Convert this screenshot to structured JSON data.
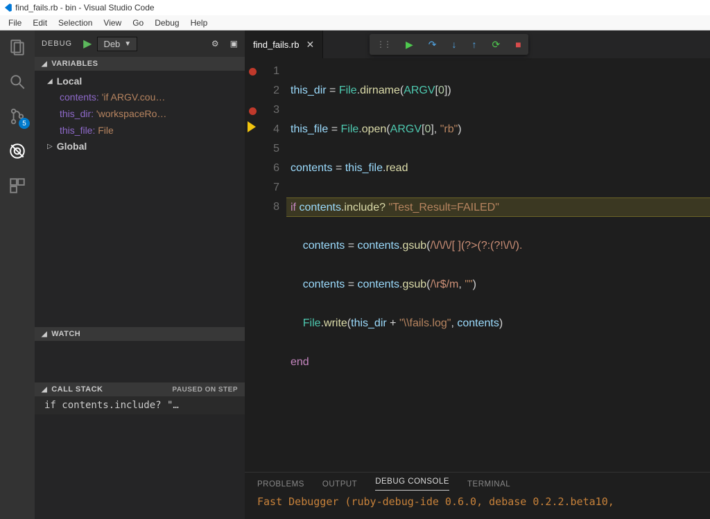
{
  "title": "find_fails.rb - bin - Visual Studio Code",
  "menubar": [
    "File",
    "Edit",
    "Selection",
    "View",
    "Go",
    "Debug",
    "Help"
  ],
  "activitybar": {
    "debug_badge": "5"
  },
  "debug_header": {
    "label": "DEBUG",
    "config": "Deb"
  },
  "sections": {
    "variables": {
      "title": "VARIABLES",
      "scopes": [
        {
          "name": "Local",
          "expanded": true,
          "vars": [
            {
              "name": "contents:",
              "value": "'if ARGV.cou…"
            },
            {
              "name": "this_dir:",
              "value": "'workspaceRo…"
            },
            {
              "name": "this_file:",
              "value": "File"
            }
          ]
        },
        {
          "name": "Global",
          "expanded": false
        }
      ]
    },
    "watch": {
      "title": "WATCH"
    },
    "callstack": {
      "title": "CALL STACK",
      "status": "PAUSED ON STEP",
      "frames": [
        "if contents.include? \"…"
      ]
    }
  },
  "tab": {
    "file": "find_fails.rb"
  },
  "code": {
    "breakpoint_lines": [
      1,
      3
    ],
    "current_line": 4,
    "lines": [
      "this_dir = File.dirname(ARGV[0])",
      "this_file = File.open(ARGV[0], \"rb\")",
      "contents = this_file.read",
      "if contents.include? \"Test_Result=FAILED\"",
      "    contents = contents.gsub(/\\/\\/\\/[ ](?>(?:(?!\\/\\/).",
      "    contents = contents.gsub(/\\r$/m, \"\")",
      "    File.write(this_dir + \"\\\\fails.log\", contents)",
      "end"
    ]
  },
  "panel": {
    "tabs": [
      "PROBLEMS",
      "OUTPUT",
      "DEBUG CONSOLE",
      "TERMINAL"
    ],
    "active": 2,
    "output": "Fast Debugger (ruby-debug-ide 0.6.0, debase 0.2.2.beta10,"
  }
}
